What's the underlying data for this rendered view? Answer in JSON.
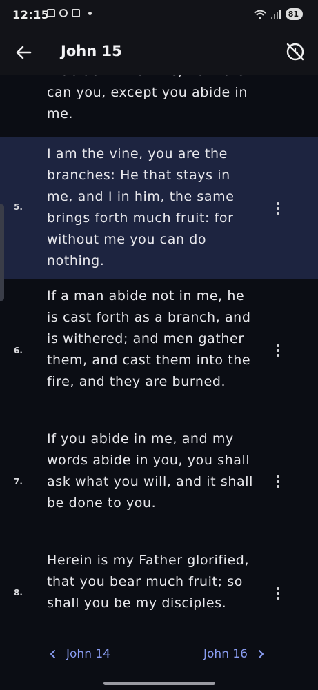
{
  "status": {
    "time": "12:15",
    "battery": "81"
  },
  "header": {
    "title": "John 15"
  },
  "verses": [
    {
      "number": "",
      "text": "it abide in the vine; no more can you, except you abide in me."
    },
    {
      "number": "5.",
      "text": "I am the vine, you are the branches: He that stays in me, and I in him, the same brings forth much fruit: for without me you can do nothing."
    },
    {
      "number": "6.",
      "text": "If a man abide not in me, he is cast forth as a branch, and is withered; and men gather them, and cast them into the fire, and they are burned."
    },
    {
      "number": "7.",
      "text": "If you abide in me, and my words abide in you, you shall ask what you will, and it shall be done to you."
    },
    {
      "number": "8.",
      "text": "Herein is my Father glorified, that you bear much fruit; so shall you be my disciples."
    }
  ],
  "footer": {
    "prev_label": "John 14",
    "next_label": "John 16"
  },
  "colors": {
    "highlight": "#1d2440",
    "link": "#8a9df2",
    "background": "#0b0d14"
  }
}
